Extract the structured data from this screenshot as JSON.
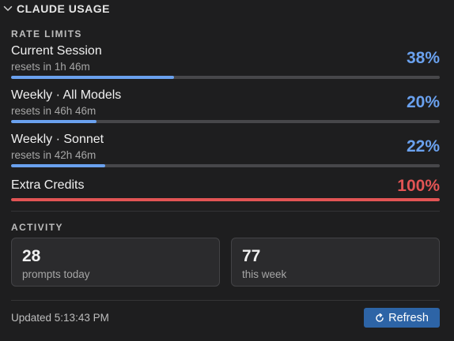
{
  "header": {
    "title": "CLAUDE USAGE",
    "icon": "chevron-down-icon"
  },
  "rate_limits": {
    "label": "RATE LIMITS",
    "items": [
      {
        "name": "Current Session",
        "reset": "resets in 1h 46m",
        "percent_label": "38%",
        "fill": 0.38,
        "color": "#6aa1ee"
      },
      {
        "name": "Weekly · All Models",
        "reset": "resets in 46h 46m",
        "percent_label": "20%",
        "fill": 0.2,
        "color": "#6aa1ee"
      },
      {
        "name": "Weekly · Sonnet",
        "reset": "resets in 42h 46m",
        "percent_label": "22%",
        "fill": 0.22,
        "color": "#6aa1ee"
      },
      {
        "name": "Extra Credits",
        "reset": "",
        "percent_label": "100%",
        "fill": 1.0,
        "color": "#e25454"
      }
    ]
  },
  "activity": {
    "label": "ACTIVITY",
    "cards": [
      {
        "value": "28",
        "label": "prompts today"
      },
      {
        "value": "77",
        "label": "this week"
      }
    ]
  },
  "footer": {
    "updated": "Updated 5:13:43 PM",
    "refresh_label": "Refresh",
    "refresh_icon": "refresh-icon"
  },
  "colors": {
    "background": "#1e1e1f",
    "accent": "#6aa1ee",
    "danger": "#e25454",
    "button": "#2d64a6",
    "track": "#47474a"
  }
}
